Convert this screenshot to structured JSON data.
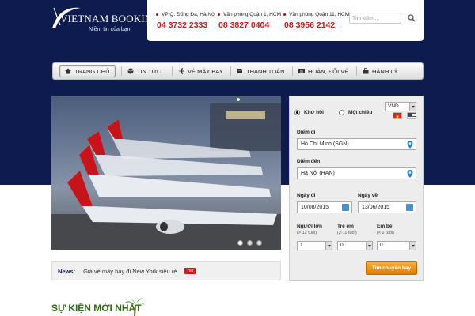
{
  "brand": {
    "name": "VIETNAM BOOKING",
    "tagline": "Niềm tin của bạn"
  },
  "offices": [
    {
      "label": "VP Q. Đống Đa, Hà Nội",
      "phone": "04 3732 2333"
    },
    {
      "label": "Văn phòng Quận 1, HCM",
      "phone": "08 3827 0404"
    },
    {
      "label": "Văn phòng Quận 11, HCM",
      "phone": "08 3956 2142"
    }
  ],
  "search": {
    "placeholder": "Tìm kiếm..."
  },
  "nav": {
    "items": [
      {
        "label": "TRANG CHỦ",
        "icon": "home-icon",
        "active": true
      },
      {
        "label": "TIN TỨC",
        "icon": "globe-icon"
      },
      {
        "label": "VÉ MÁY BAY",
        "icon": "plane-icon"
      },
      {
        "label": "THANH TOÁN",
        "icon": "payment-icon"
      },
      {
        "label": "HOÀN, ĐỔI VÉ",
        "icon": "exchange-icon"
      },
      {
        "label": "HÀNH LÝ",
        "icon": "luggage-icon"
      }
    ]
  },
  "slider": {
    "slides": 3,
    "active_slide": 1,
    "image": "JAPAN AIRLINES JAL aircraft at airport"
  },
  "news": {
    "label": "News:",
    "text": "Giá vé máy bay đi New York siêu rẻ",
    "badge": "Hot"
  },
  "booking": {
    "currency": "VND",
    "trip_types": [
      {
        "label": "Khứ hồi",
        "selected": true
      },
      {
        "label": "Một chiều",
        "selected": false
      }
    ],
    "from": {
      "label": "Điểm đi",
      "value": "Hồ Chí Minh (SGN)"
    },
    "to": {
      "label": "Điểm đến",
      "value": "Hà Nội (HAN)"
    },
    "depart": {
      "label": "Ngày đi",
      "value": "10/08/2015"
    },
    "return": {
      "label": "Ngày về",
      "value": "13/06/2015"
    },
    "adults": {
      "label": "Người lớn",
      "sub": "(> 12 tuổi)",
      "value": "1"
    },
    "children": {
      "label": "Trẻ em",
      "sub": "(2-11 tuổi)",
      "value": "0"
    },
    "infants": {
      "label": "Em bé",
      "sub": "(< 2 tuổi)",
      "value": "0"
    },
    "submit": "Tìm chuyến bay"
  },
  "events": {
    "title": "SỰ KIỆN MỚI NHẤT"
  },
  "colors": {
    "header_bg": "#0d1b4f",
    "phone_red": "#d7141a",
    "button_orange": "#f39200"
  }
}
